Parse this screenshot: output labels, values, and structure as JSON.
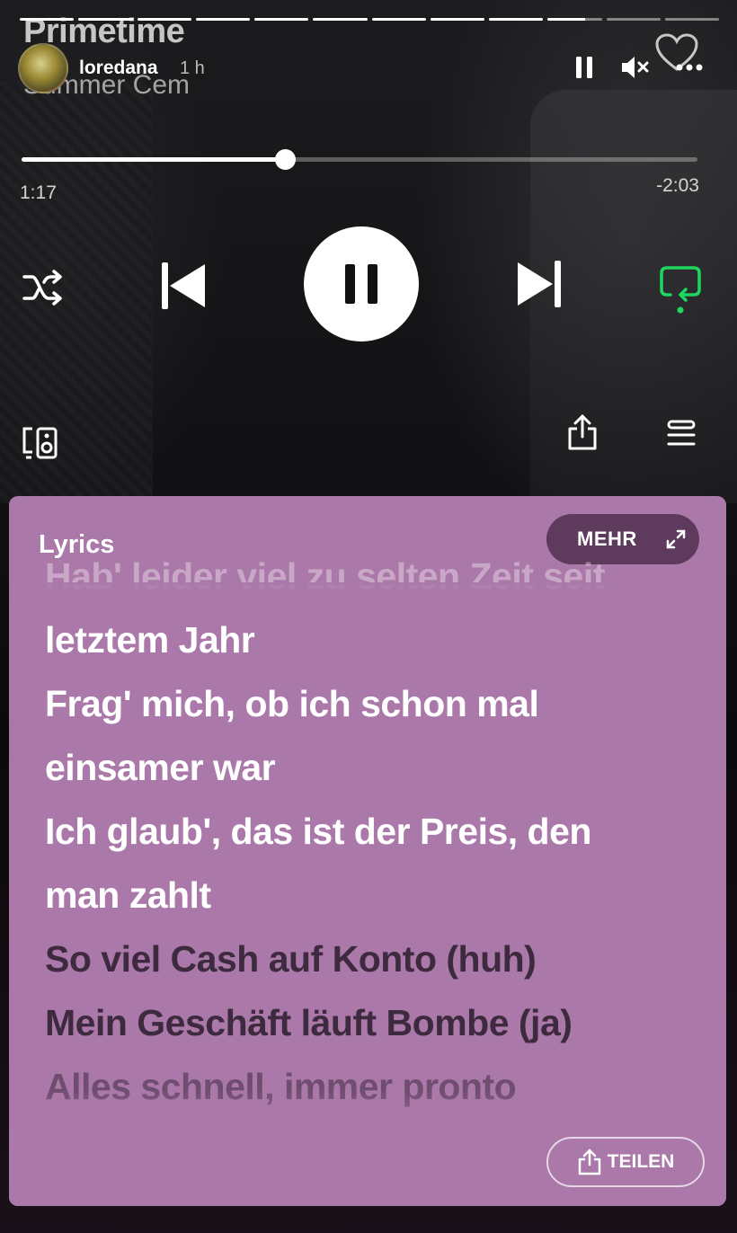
{
  "story": {
    "progress": [
      1,
      1,
      1,
      1,
      1,
      1,
      1,
      1,
      1,
      0.7,
      0,
      0
    ],
    "username": "loredana",
    "time_ago": "1 h"
  },
  "track": {
    "title": "Primetime",
    "artist": "Summer Cem",
    "elapsed": "1:17",
    "remaining": "-2:03",
    "progress": 0.39
  },
  "colors": {
    "accent_green": "#1ed760",
    "lyrics_card": "#ab78aa",
    "mehr_button": "#5e3a5c"
  },
  "lyrics": {
    "header": "Lyrics",
    "more_label": "MEHR",
    "share_label": "TEILEN",
    "lines": [
      "Hab' leider viel zu selten Zeit seit",
      "letztem Jahr",
      "Frag' mich, ob ich schon mal",
      "einsamer war",
      "Ich glaub', das ist der Preis, den",
      "man zahlt",
      "So viel Cash auf Konto (huh)",
      "Mein Geschäft läuft Bombe (ja)",
      "Alles schnell, immer pronto"
    ]
  },
  "icons": {
    "story_pause": "pause-icon",
    "mute": "speaker-muted-icon",
    "like": "heart-icon",
    "more": "more-dots-icon",
    "shuffle": "shuffle-icon",
    "previous": "skip-previous-icon",
    "play_pause": "pause-icon",
    "next": "skip-next-icon",
    "repeat": "repeat-icon",
    "devices": "connect-devices-icon",
    "share": "share-icon",
    "queue": "queue-icon",
    "expand": "expand-icon"
  }
}
